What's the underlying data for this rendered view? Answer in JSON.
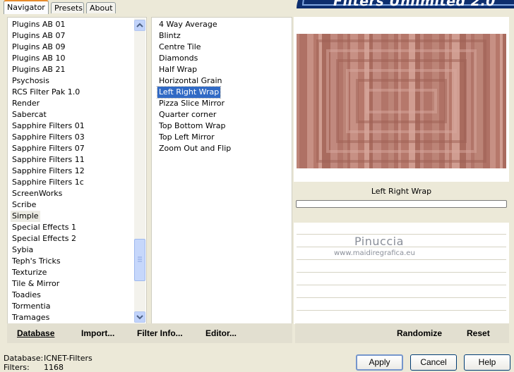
{
  "tabs": [
    {
      "label": "Navigator"
    },
    {
      "label": "Presets"
    },
    {
      "label": "About"
    }
  ],
  "banner": {
    "title": "Filters Unlimited 2.0"
  },
  "categories": [
    "Plugins AB 01",
    "Plugins AB 07",
    "Plugins AB 09",
    "Plugins AB 10",
    "Plugins AB 21",
    "Psychosis",
    "RCS Filter Pak 1.0",
    "Render",
    "Sabercat",
    "Sapphire Filters 01",
    "Sapphire Filters 03",
    "Sapphire Filters 07",
    "Sapphire Filters 11",
    "Sapphire Filters 12",
    "Sapphire Filters 1c",
    "ScreenWorks",
    "Scribe",
    "Simple",
    "Special Effects 1",
    "Special Effects 2",
    "Sybia",
    "Teph's Tricks",
    "Texturize",
    "Tile & Mirror",
    "Toadies",
    "Tormentia",
    "Tramages"
  ],
  "selected_category": "Simple",
  "filters": [
    "4 Way Average",
    "Blintz",
    "Centre Tile",
    "Diamonds",
    "Half Wrap",
    "Horizontal Grain",
    "Left Right Wrap",
    "Pizza Slice Mirror",
    "Quarter corner",
    "Top Bottom Wrap",
    "Top Left Mirror",
    "Zoom Out and Flip"
  ],
  "selected_filter": "Left Right Wrap",
  "preview": {
    "filter_name": "Left Right Wrap",
    "progress": 0
  },
  "watermark": {
    "name": "Pinuccia",
    "url": "www.maidiregrafica.eu"
  },
  "toolbar": {
    "database": "Database",
    "import": "Import...",
    "filter_info": "Filter Info...",
    "editor": "Editor...",
    "randomize": "Randomize",
    "reset": "Reset"
  },
  "status": {
    "database_label": "Database:",
    "database_value": "ICNET-Filters",
    "filters_label": "Filters:",
    "filters_value": "1168"
  },
  "buttons": {
    "apply": "Apply",
    "cancel": "Cancel",
    "help": "Help"
  },
  "colors": {
    "preview_base": "#b87c70",
    "selection": "#316ac5",
    "banner": "#0d2e6e"
  }
}
